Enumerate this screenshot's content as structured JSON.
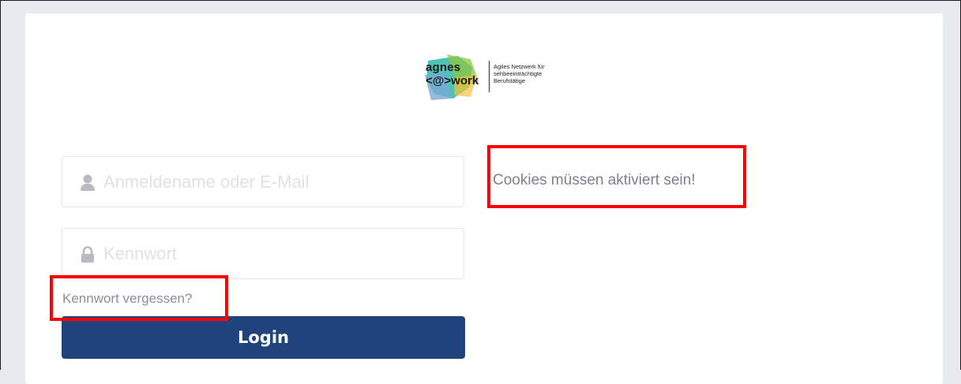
{
  "logo": {
    "word_top": "agnes",
    "word_bottom": "<@>work",
    "tagline": [
      "Agiles Netzwerk für",
      "sehbeeinträchtigte",
      "Berufstätige"
    ],
    "colors": [
      "#2db9a8",
      "#8dc63f",
      "#7aa9d6",
      "#f3c33c"
    ]
  },
  "login": {
    "username_placeholder": "Anmeldename oder E-Mail",
    "username_value": "",
    "password_placeholder": "Kennwort",
    "password_value": "",
    "forgot_label": "Kennwort vergessen?",
    "login_label": "Login",
    "login_color": "#1f447b"
  },
  "notice": {
    "cookies_text": "Cookies müssen aktiviert sein!"
  },
  "icons": {
    "username": "user-icon",
    "password": "lock-icon"
  },
  "highlight_color": "#ff0000"
}
